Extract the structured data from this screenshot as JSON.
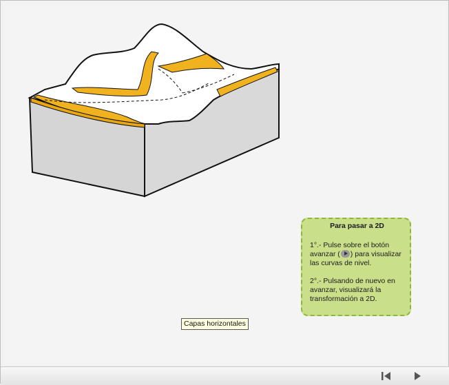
{
  "info_box": {
    "title": "Para pasar a 2D",
    "step1_before": "1°.- Pulse sobre el botón avanzar (",
    "step1_after": ") para visualizar las curvas de nivel.",
    "step2": "2°.- Pulsando de nuevo en avanzar, visualizará la transformación a 2D."
  },
  "tooltip": {
    "text": "Capas horizontales"
  },
  "navigation": {
    "first_icon": "skip-to-start-icon",
    "next_icon": "play-next-icon"
  },
  "colors": {
    "box_fill": "#c9df8a",
    "box_border": "#8cb83a",
    "contour_band": "#f0b21e",
    "block_side": "#d4d4d4"
  }
}
